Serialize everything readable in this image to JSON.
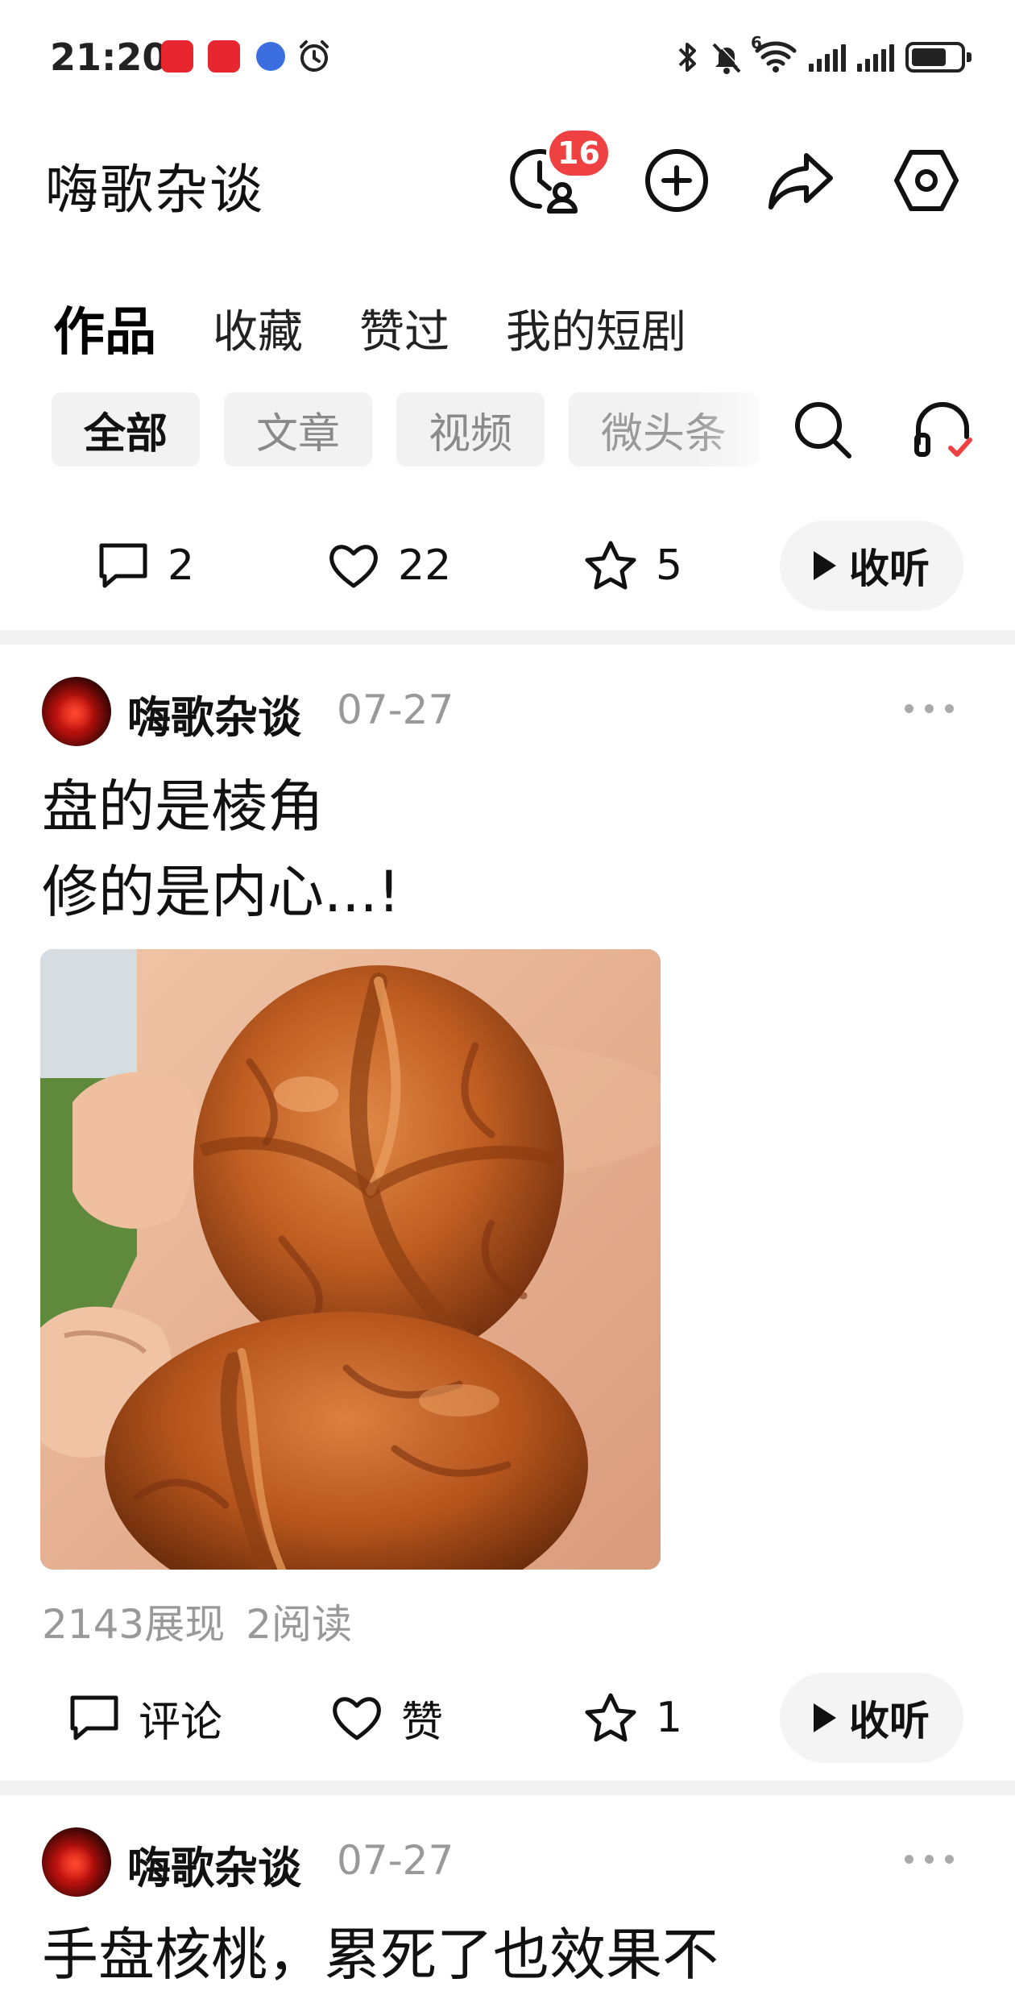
{
  "status_bar": {
    "time": "21:20",
    "network_label": "6"
  },
  "header": {
    "title": "嗨歌杂谈",
    "history_badge": "16",
    "icons": [
      "history-user-icon",
      "add-icon",
      "share-icon",
      "settings-icon"
    ]
  },
  "main_tabs": [
    {
      "label": "作品",
      "active": true
    },
    {
      "label": "收藏",
      "active": false
    },
    {
      "label": "赞过",
      "active": false
    },
    {
      "label": "我的短剧",
      "active": false
    }
  ],
  "filter_chips": [
    {
      "label": "全部",
      "active": true
    },
    {
      "label": "文章",
      "active": false
    },
    {
      "label": "视频",
      "active": false
    },
    {
      "label": "微头条",
      "active": false
    }
  ],
  "prev_post_actions": {
    "comments": "2",
    "likes": "22",
    "favorites": "5",
    "listen": "收听"
  },
  "post1": {
    "author": "嗨歌杂谈",
    "date": "07-27",
    "text": "盘的是棱角\n修的是内心...!",
    "views": "2143展现",
    "reads": "2阅读",
    "comment_label": "评论",
    "like_label": "赞",
    "favorites": "1",
    "listen": "收听"
  },
  "post2": {
    "author": "嗨歌杂谈",
    "date": "07-27",
    "text_partial": "手盘核桃，累死了也效果不"
  },
  "colors": {
    "badge": "#f04142",
    "chip_bg": "#f2f2f2",
    "muted_text": "#999999",
    "check_accent": "#f04142"
  }
}
